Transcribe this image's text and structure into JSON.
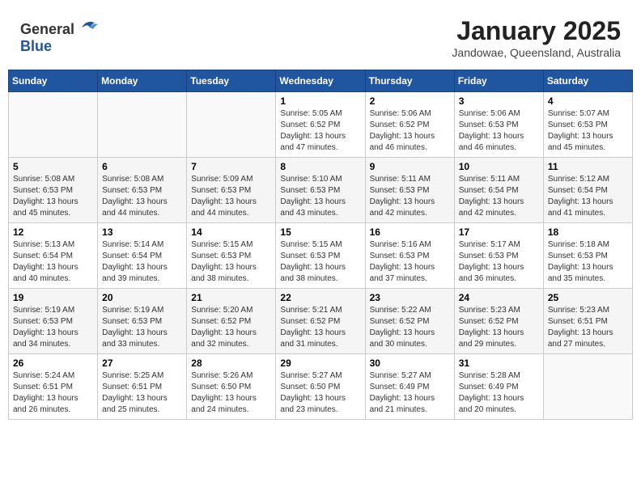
{
  "header": {
    "logo_general": "General",
    "logo_blue": "Blue",
    "title": "January 2025",
    "subtitle": "Jandowae, Queensland, Australia"
  },
  "weekdays": [
    "Sunday",
    "Monday",
    "Tuesday",
    "Wednesday",
    "Thursday",
    "Friday",
    "Saturday"
  ],
  "weeks": [
    [
      {
        "day": "",
        "info": ""
      },
      {
        "day": "",
        "info": ""
      },
      {
        "day": "",
        "info": ""
      },
      {
        "day": "1",
        "info": "Sunrise: 5:05 AM\nSunset: 6:52 PM\nDaylight: 13 hours\nand 47 minutes."
      },
      {
        "day": "2",
        "info": "Sunrise: 5:06 AM\nSunset: 6:52 PM\nDaylight: 13 hours\nand 46 minutes."
      },
      {
        "day": "3",
        "info": "Sunrise: 5:06 AM\nSunset: 6:53 PM\nDaylight: 13 hours\nand 46 minutes."
      },
      {
        "day": "4",
        "info": "Sunrise: 5:07 AM\nSunset: 6:53 PM\nDaylight: 13 hours\nand 45 minutes."
      }
    ],
    [
      {
        "day": "5",
        "info": "Sunrise: 5:08 AM\nSunset: 6:53 PM\nDaylight: 13 hours\nand 45 minutes."
      },
      {
        "day": "6",
        "info": "Sunrise: 5:08 AM\nSunset: 6:53 PM\nDaylight: 13 hours\nand 44 minutes."
      },
      {
        "day": "7",
        "info": "Sunrise: 5:09 AM\nSunset: 6:53 PM\nDaylight: 13 hours\nand 44 minutes."
      },
      {
        "day": "8",
        "info": "Sunrise: 5:10 AM\nSunset: 6:53 PM\nDaylight: 13 hours\nand 43 minutes."
      },
      {
        "day": "9",
        "info": "Sunrise: 5:11 AM\nSunset: 6:53 PM\nDaylight: 13 hours\nand 42 minutes."
      },
      {
        "day": "10",
        "info": "Sunrise: 5:11 AM\nSunset: 6:54 PM\nDaylight: 13 hours\nand 42 minutes."
      },
      {
        "day": "11",
        "info": "Sunrise: 5:12 AM\nSunset: 6:54 PM\nDaylight: 13 hours\nand 41 minutes."
      }
    ],
    [
      {
        "day": "12",
        "info": "Sunrise: 5:13 AM\nSunset: 6:54 PM\nDaylight: 13 hours\nand 40 minutes."
      },
      {
        "day": "13",
        "info": "Sunrise: 5:14 AM\nSunset: 6:54 PM\nDaylight: 13 hours\nand 39 minutes."
      },
      {
        "day": "14",
        "info": "Sunrise: 5:15 AM\nSunset: 6:53 PM\nDaylight: 13 hours\nand 38 minutes."
      },
      {
        "day": "15",
        "info": "Sunrise: 5:15 AM\nSunset: 6:53 PM\nDaylight: 13 hours\nand 38 minutes."
      },
      {
        "day": "16",
        "info": "Sunrise: 5:16 AM\nSunset: 6:53 PM\nDaylight: 13 hours\nand 37 minutes."
      },
      {
        "day": "17",
        "info": "Sunrise: 5:17 AM\nSunset: 6:53 PM\nDaylight: 13 hours\nand 36 minutes."
      },
      {
        "day": "18",
        "info": "Sunrise: 5:18 AM\nSunset: 6:53 PM\nDaylight: 13 hours\nand 35 minutes."
      }
    ],
    [
      {
        "day": "19",
        "info": "Sunrise: 5:19 AM\nSunset: 6:53 PM\nDaylight: 13 hours\nand 34 minutes."
      },
      {
        "day": "20",
        "info": "Sunrise: 5:19 AM\nSunset: 6:53 PM\nDaylight: 13 hours\nand 33 minutes."
      },
      {
        "day": "21",
        "info": "Sunrise: 5:20 AM\nSunset: 6:52 PM\nDaylight: 13 hours\nand 32 minutes."
      },
      {
        "day": "22",
        "info": "Sunrise: 5:21 AM\nSunset: 6:52 PM\nDaylight: 13 hours\nand 31 minutes."
      },
      {
        "day": "23",
        "info": "Sunrise: 5:22 AM\nSunset: 6:52 PM\nDaylight: 13 hours\nand 30 minutes."
      },
      {
        "day": "24",
        "info": "Sunrise: 5:23 AM\nSunset: 6:52 PM\nDaylight: 13 hours\nand 29 minutes."
      },
      {
        "day": "25",
        "info": "Sunrise: 5:23 AM\nSunset: 6:51 PM\nDaylight: 13 hours\nand 27 minutes."
      }
    ],
    [
      {
        "day": "26",
        "info": "Sunrise: 5:24 AM\nSunset: 6:51 PM\nDaylight: 13 hours\nand 26 minutes."
      },
      {
        "day": "27",
        "info": "Sunrise: 5:25 AM\nSunset: 6:51 PM\nDaylight: 13 hours\nand 25 minutes."
      },
      {
        "day": "28",
        "info": "Sunrise: 5:26 AM\nSunset: 6:50 PM\nDaylight: 13 hours\nand 24 minutes."
      },
      {
        "day": "29",
        "info": "Sunrise: 5:27 AM\nSunset: 6:50 PM\nDaylight: 13 hours\nand 23 minutes."
      },
      {
        "day": "30",
        "info": "Sunrise: 5:27 AM\nSunset: 6:49 PM\nDaylight: 13 hours\nand 21 minutes."
      },
      {
        "day": "31",
        "info": "Sunrise: 5:28 AM\nSunset: 6:49 PM\nDaylight: 13 hours\nand 20 minutes."
      },
      {
        "day": "",
        "info": ""
      }
    ]
  ]
}
